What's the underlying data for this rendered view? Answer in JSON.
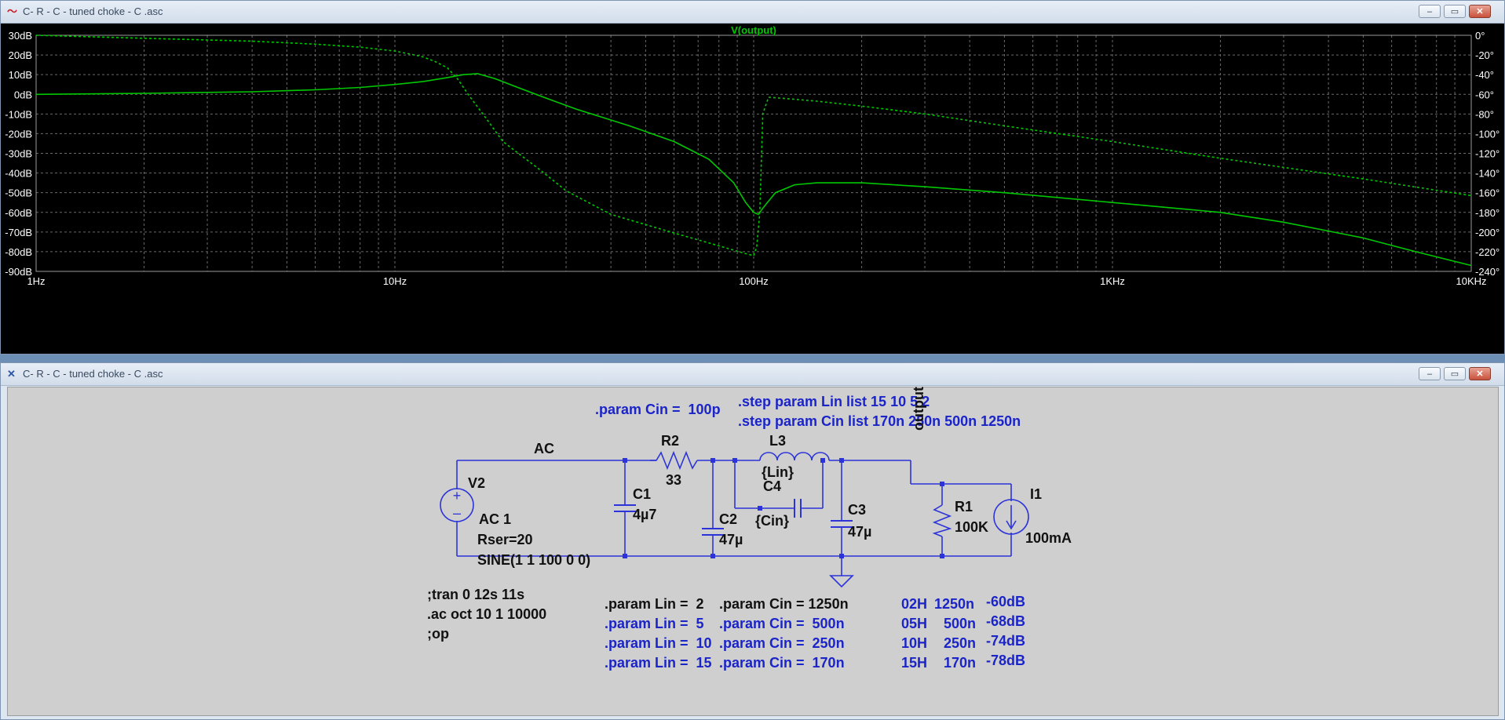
{
  "plot_window": {
    "title": "C- R - C - tuned choke - C .asc",
    "trace_label": "V(output)",
    "left_axis_ticks": [
      "30dB",
      "20dB",
      "10dB",
      "0dB",
      "-10dB",
      "-20dB",
      "-30dB",
      "-40dB",
      "-50dB",
      "-60dB",
      "-70dB",
      "-80dB",
      "-90dB"
    ],
    "right_axis_ticks": [
      "0°",
      "-20°",
      "-40°",
      "-60°",
      "-80°",
      "-100°",
      "-120°",
      "-140°",
      "-160°",
      "-180°",
      "-200°",
      "-220°",
      "-240°"
    ],
    "x_axis_ticks": [
      "1Hz",
      "10Hz",
      "100Hz",
      "1KHz",
      "10KHz"
    ],
    "colors": {
      "background": "#000000",
      "trace": "#00c800",
      "grid": "#6a6a6a",
      "axis_text": "#ffffff"
    }
  },
  "chart_data": {
    "type": "line",
    "x_scale": "log",
    "xlim": [
      1,
      10000
    ],
    "ylim": [
      -90,
      30
    ],
    "y2lim": [
      -240,
      0
    ],
    "xlabel": "",
    "ylabel": "",
    "grid": true,
    "series": [
      {
        "name": "V(output)",
        "axis": "magnitude",
        "style": "solid",
        "x": [
          1,
          2,
          4,
          6,
          8,
          10,
          12,
          14,
          15.5,
          17,
          19,
          22,
          26,
          32,
          45,
          60,
          75,
          88,
          95,
          100,
          103,
          107,
          115,
          130,
          150,
          175,
          200,
          300,
          500,
          1000,
          2000,
          3000,
          5000,
          7000,
          10000
        ],
        "y": [
          0,
          0.5,
          1.3,
          2.3,
          3.5,
          5,
          6.5,
          8.5,
          10,
          10.5,
          8,
          3.5,
          -1.5,
          -7.5,
          -16,
          -24,
          -33,
          -45,
          -55,
          -60,
          -61,
          -57,
          -50,
          -46,
          -45,
          -45,
          -45,
          -47,
          -50,
          -55,
          -60,
          -65,
          -73,
          -80,
          -87
        ]
      },
      {
        "name": "V(output)",
        "axis": "phase",
        "style": "dashed",
        "x": [
          1,
          2,
          4,
          6,
          8,
          10,
          11,
          12,
          13,
          14,
          15,
          16,
          18,
          20,
          25,
          30,
          40,
          60,
          80,
          95,
          100,
          102,
          104,
          106,
          110,
          120,
          150,
          200,
          300,
          500,
          1000,
          2000,
          5000,
          10000
        ],
        "y": [
          0,
          -3,
          -6,
          -9,
          -12,
          -16,
          -19,
          -22,
          -27,
          -33,
          -45,
          -60,
          -85,
          -108,
          -135,
          -158,
          -182,
          -201,
          -214,
          -222,
          -224,
          -215,
          -180,
          -80,
          -63,
          -64,
          -67,
          -72,
          -80,
          -92,
          -108,
          -125,
          -146,
          -163
        ]
      }
    ]
  },
  "schematic_window": {
    "title": "C- R - C - tuned choke - C .asc",
    "colors": {
      "background": "#cfcfcf",
      "wire": "#2c34d9",
      "directive": "#1a24c8",
      "label": "#111111"
    },
    "directives_top": {
      "param_cin": ".param Cin =  100p",
      "step_lin": ".step param Lin list 15 10 5 2",
      "step_cin": ".step param Cin list 170n 250n 500n 1250n"
    },
    "net_labels": {
      "ac": "AC",
      "output": "output"
    },
    "components": {
      "v2": {
        "name": "V2",
        "line1": "AC 1",
        "line2": "Rser=20",
        "line3": "SINE(1 1 100 0 0)"
      },
      "r2": {
        "name": "R2",
        "value": "33"
      },
      "c1": {
        "name": "C1",
        "value": "4µ7"
      },
      "c2": {
        "name": "C2",
        "value": "47µ"
      },
      "l3": {
        "name": "L3",
        "value": "{Lin}"
      },
      "c4": {
        "name": "C4",
        "value": "{Cin}"
      },
      "c3": {
        "name": "C3",
        "value": "47µ"
      },
      "r1": {
        "name": "R1",
        "value": "100K"
      },
      "i1": {
        "name": "I1",
        "value": "100mA"
      }
    },
    "commands": [
      ";tran 0 12s 11s",
      ".ac oct 10 1 10000",
      ";op"
    ],
    "param_table": [
      {
        "lin": ".param Lin =  2",
        "cin": ".param Cin = 1250n",
        "active": true
      },
      {
        "lin": ".param Lin =  5",
        "cin": ".param Cin =  500n",
        "active": false
      },
      {
        "lin": ".param Lin =  10",
        "cin": ".param Cin =  250n",
        "active": false
      },
      {
        "lin": ".param Lin =  15",
        "cin": ".param Cin =  170n",
        "active": false
      }
    ],
    "results": [
      {
        "lh": "02H",
        "cn": "1250n",
        "db": "-60dB"
      },
      {
        "lh": "05H",
        "cn": "500n",
        "db": "-68dB"
      },
      {
        "lh": "10H",
        "cn": "250n",
        "db": "-74dB"
      },
      {
        "lh": "15H",
        "cn": "170n",
        "db": "-78dB"
      }
    ]
  }
}
